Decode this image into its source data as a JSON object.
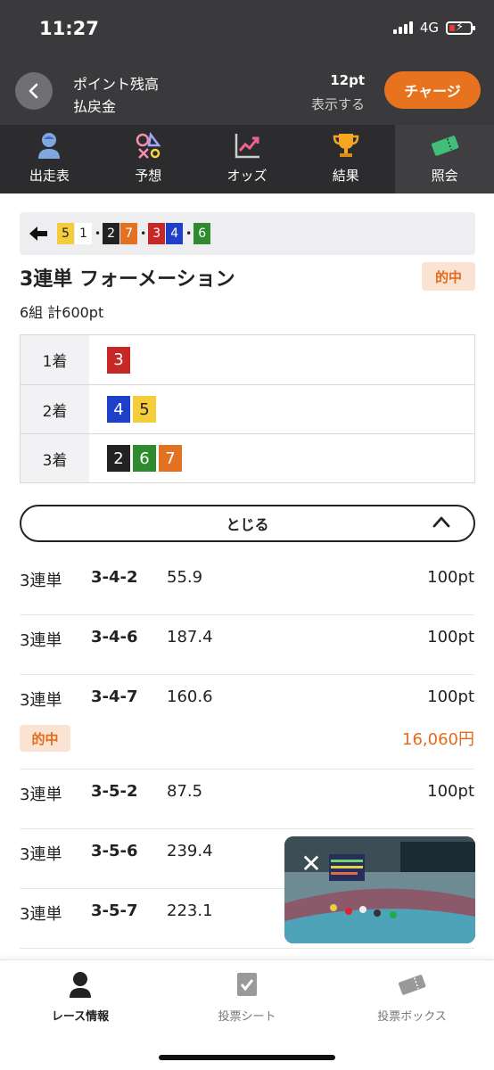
{
  "status": {
    "time": "11:27",
    "network": "4G"
  },
  "header": {
    "points_label": "ポイント残高",
    "refund_label": "払戻金",
    "points_value": "12pt",
    "refund_value": "表示する",
    "charge_label": "チャージ"
  },
  "top_nav": [
    {
      "label": "出走表",
      "icon": "racer-icon"
    },
    {
      "label": "予想",
      "icon": "prediction-icon"
    },
    {
      "label": "オッズ",
      "icon": "odds-chart-icon"
    },
    {
      "label": "結果",
      "icon": "trophy-icon"
    },
    {
      "label": "照会",
      "icon": "ticket-icon",
      "active": true
    }
  ],
  "combo_bar": {
    "groups": [
      [
        "5",
        "1"
      ],
      [
        "2",
        "7"
      ],
      [
        "3",
        "4"
      ],
      [
        "6"
      ]
    ],
    "separator": "•"
  },
  "bet": {
    "title": "3連単 フォーメーション",
    "hit_badge": "的中",
    "summary": "6組 計600pt"
  },
  "places": [
    {
      "label": "1着",
      "numbers": [
        "3"
      ]
    },
    {
      "label": "2着",
      "numbers": [
        "4",
        "5"
      ]
    },
    {
      "label": "3着",
      "numbers": [
        "2",
        "6",
        "7"
      ]
    }
  ],
  "close_label": "とじる",
  "bets": [
    {
      "type": "3連単",
      "combo": "3-4-2",
      "odds": "55.9",
      "amount": "100pt"
    },
    {
      "type": "3連単",
      "combo": "3-4-6",
      "odds": "187.4",
      "amount": "100pt"
    },
    {
      "type": "3連単",
      "combo": "3-4-7",
      "odds": "160.6",
      "amount": "100pt",
      "hit": "的中",
      "payout": "16,060円"
    },
    {
      "type": "3連単",
      "combo": "3-5-2",
      "odds": "87.5",
      "amount": "100pt"
    },
    {
      "type": "3連単",
      "combo": "3-5-6",
      "odds": "239.4",
      "amount": ""
    },
    {
      "type": "3連単",
      "combo": "3-5-7",
      "odds": "223.1",
      "amount": ""
    }
  ],
  "bottom_nav": [
    {
      "label": "レース情報",
      "icon": "racer-icon",
      "active": true
    },
    {
      "label": "投票シート",
      "icon": "checksheet-icon"
    },
    {
      "label": "投票ボックス",
      "icon": "ticket-box-icon"
    }
  ],
  "colors": {
    "accent": "#e8731e",
    "hit_bg": "#fbe3d3",
    "hit_text": "#e36b1a",
    "header_bg": "#3a3a3c",
    "num_colors": {
      "1": {
        "bg": "#ffffff",
        "fg": "#222222"
      },
      "2": {
        "bg": "#222222",
        "fg": "#ffffff"
      },
      "3": {
        "bg": "#c62828",
        "fg": "#ffffff"
      },
      "4": {
        "bg": "#1e40c9",
        "fg": "#ffffff"
      },
      "5": {
        "bg": "#f5cd3a",
        "fg": "#222222"
      },
      "6": {
        "bg": "#2e8b2e",
        "fg": "#ffffff"
      },
      "7": {
        "bg": "#e27122",
        "fg": "#ffffff"
      }
    }
  }
}
